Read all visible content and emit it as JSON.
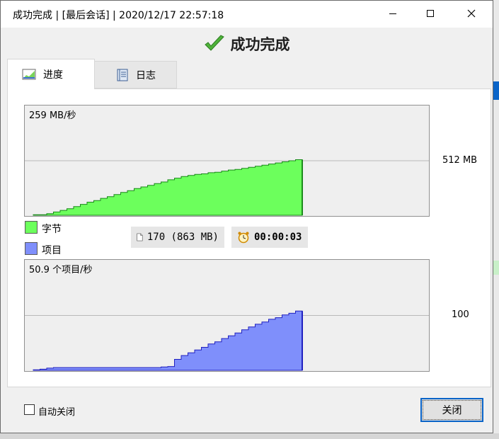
{
  "window": {
    "title": "成功完成 | [最后会话] | 2020/12/17 22:57:18",
    "heading": "成功完成"
  },
  "tabs": [
    {
      "label": "进度",
      "icon": "progress-chart-icon",
      "active": true
    },
    {
      "label": "日志",
      "icon": "log-book-icon",
      "active": false
    }
  ],
  "bytes_chart": {
    "rate_label": "259 MB/秒",
    "scale_label": "512 MB",
    "legend": "字节",
    "color": "#6cff5c",
    "line_color": "#1a8a1a"
  },
  "items_chart": {
    "rate_label": "50.9 个项目/秒",
    "scale_label": "100",
    "legend": "项目",
    "color": "#7f8ffb",
    "line_color": "#2020c0"
  },
  "stats": {
    "items": "170 (863 MB)",
    "elapsed": "00:00:03"
  },
  "footer": {
    "auto_close_label": "自动关闭",
    "auto_close_checked": false,
    "close_button_label": "关闭"
  },
  "chart_data": [
    {
      "type": "area",
      "title": "259 MB/秒",
      "series": [
        {
          "name": "字节",
          "values": [
            0.01,
            0.01,
            0.03,
            0.06,
            0.09,
            0.12,
            0.16,
            0.2,
            0.24,
            0.27,
            0.31,
            0.34,
            0.38,
            0.42,
            0.45,
            0.49,
            0.52,
            0.55,
            0.58,
            0.61,
            0.65,
            0.68,
            0.71,
            0.73,
            0.75,
            0.76,
            0.78,
            0.79,
            0.81,
            0.83,
            0.84,
            0.86,
            0.88,
            0.9,
            0.92,
            0.94,
            0.96,
            0.98,
            1.0,
            1.02
          ]
        }
      ],
      "y_reference": "512 MB"
    },
    {
      "type": "area",
      "title": "50.9 个项目/秒",
      "series": [
        {
          "name": "项目",
          "values": [
            0.01,
            0.02,
            0.04,
            0.05,
            0.05,
            0.05,
            0.05,
            0.05,
            0.05,
            0.05,
            0.05,
            0.05,
            0.05,
            0.05,
            0.05,
            0.05,
            0.05,
            0.05,
            0.05,
            0.06,
            0.07,
            0.2,
            0.27,
            0.32,
            0.37,
            0.42,
            0.48,
            0.52,
            0.58,
            0.63,
            0.68,
            0.74,
            0.79,
            0.84,
            0.88,
            0.93,
            0.96,
            1.01,
            1.04,
            1.08
          ]
        }
      ],
      "y_reference": "100"
    }
  ]
}
